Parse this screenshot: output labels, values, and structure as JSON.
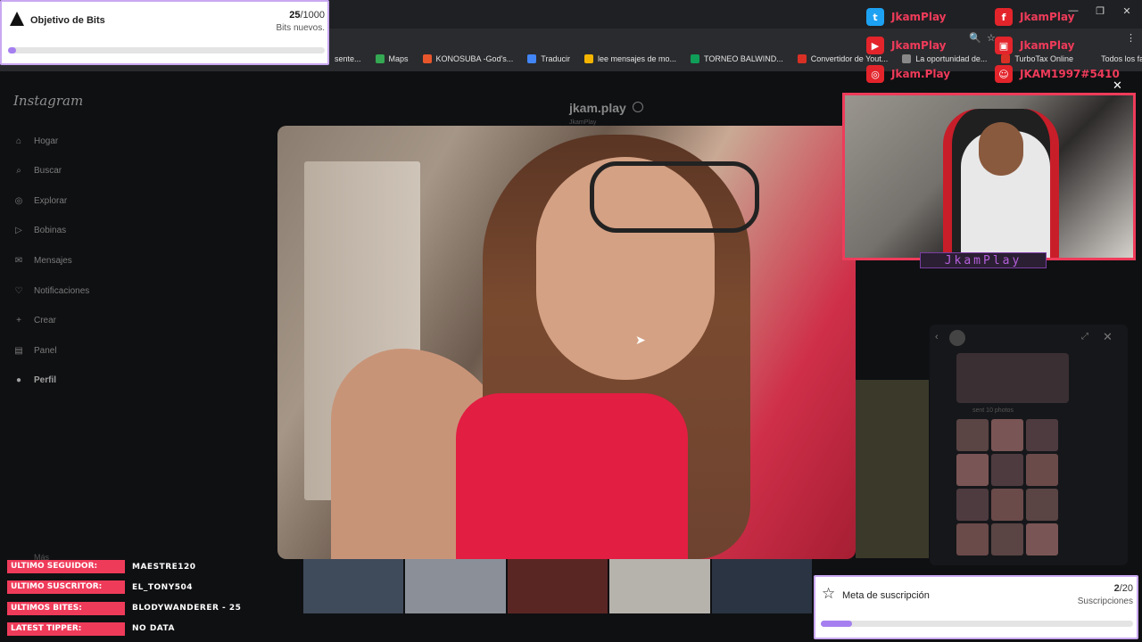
{
  "browser": {
    "bookmarks": [
      {
        "label": "sente...",
        "color": "#2a2b2e"
      },
      {
        "label": "Maps",
        "color": "#34a853"
      },
      {
        "label": "KONOSUBA -God's...",
        "color": "#e8562b"
      },
      {
        "label": "Traducir",
        "color": "#4285f4"
      },
      {
        "label": "lee mensajes de mo...",
        "color": "#f4b400"
      },
      {
        "label": "TORNEO BALWIND...",
        "color": "#0f9d58"
      },
      {
        "label": "Convertidor de Yout...",
        "color": "#d93025"
      },
      {
        "label": "La oportunidad de...",
        "color": "#888888"
      },
      {
        "label": "TurboTax Online",
        "color": "#d93025"
      },
      {
        "label": "Todos los favoritos",
        "color": "#2a2b2e"
      }
    ]
  },
  "instagram": {
    "logo": "Instagram",
    "nav": [
      "Hogar",
      "Buscar",
      "Explorar",
      "Bobinas",
      "Mensajes",
      "Notificaciones",
      "Crear",
      "Panel",
      "Perfil"
    ],
    "profile_name": "jkam.play",
    "profile_sub": "JkamPlay",
    "sent_photos": "sent 10 photos",
    "more": "Más"
  },
  "bits_goal": {
    "title": "Objetivo de Bits",
    "current": "25",
    "total": "/1000",
    "subtitle": "Bits nuevos.",
    "progress": 0.025
  },
  "socials": [
    {
      "name": "JkamPlay",
      "icon": "twitter-icon",
      "color": "#1da1f2"
    },
    {
      "name": "JkamPlay",
      "icon": "facebook-icon",
      "color": "#e3242b"
    },
    {
      "name": "JkamPlay",
      "icon": "youtube-icon",
      "color": "#e3242b"
    },
    {
      "name": "JkamPlay",
      "icon": "twitch-icon",
      "color": "#e3242b"
    },
    {
      "name": "Jkam.Play",
      "icon": "instagram-icon",
      "color": "#e3242b"
    },
    {
      "name": "JKAM1997#5410",
      "icon": "discord-icon",
      "color": "#e3242b"
    }
  ],
  "webcam": {
    "name": "JkamPlay"
  },
  "stream_stats": [
    {
      "label": "ULTIMO SEGUIDOR:",
      "value": "MAESTRE120"
    },
    {
      "label": "ULTIMO SUSCRITOR:",
      "value": "EL_TONY504"
    },
    {
      "label": "ULTIMOS BITES:",
      "value": "BLODYWANDERER - 25"
    },
    {
      "label": "LATEST TIPPER:",
      "value": "NO DATA"
    }
  ],
  "subs_goal": {
    "title": "Meta de suscripción",
    "current": "2",
    "total": "/20",
    "subtitle": "Suscripciones",
    "progress": 0.1
  },
  "accent": "#ef3b5a",
  "goal_fill": "#a57ff0"
}
